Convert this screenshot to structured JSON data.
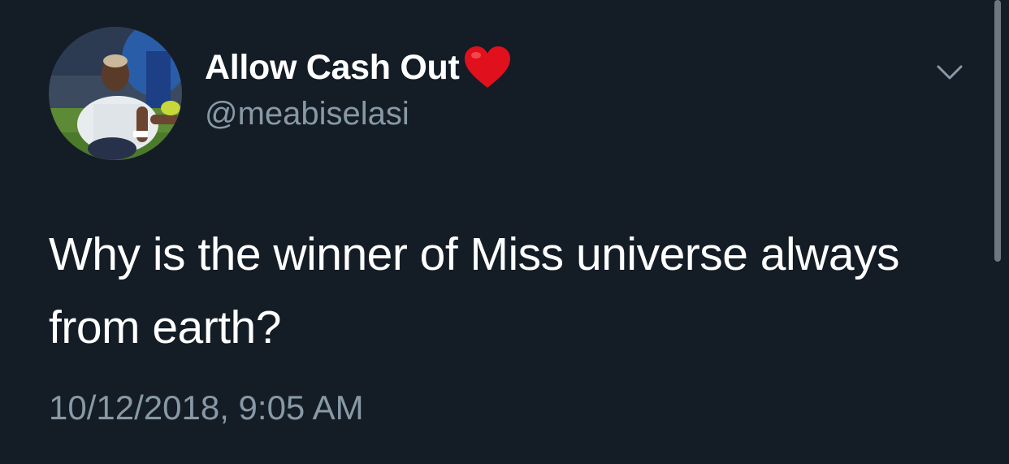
{
  "tweet": {
    "display_name": "Allow Cash Out",
    "name_emoji": "heart-emoji",
    "handle": "@meabiselasi",
    "text": "Why is the winner of Miss universe always from earth?",
    "timestamp": "10/12/2018, 9:05 AM"
  },
  "colors": {
    "background": "#141d26",
    "primary_text": "#ffffff",
    "secondary_text": "#8899a6",
    "heart": "#e0101d"
  },
  "icons": {
    "menu": "chevron-down-icon",
    "emoji": "heart-icon"
  }
}
